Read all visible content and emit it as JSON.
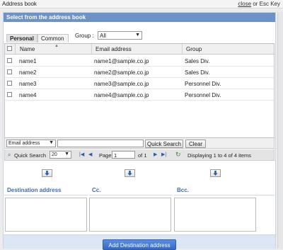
{
  "window": {
    "title": "Address book",
    "close_link": "close",
    "close_suffix": " or Esc Key"
  },
  "dialog": {
    "header": "Select from the address book"
  },
  "tabs": [
    {
      "label": "Personal",
      "active": true
    },
    {
      "label": "Common",
      "active": false
    }
  ],
  "group": {
    "label": "Group :",
    "value": "All"
  },
  "table": {
    "columns": [
      "Name",
      "Email address",
      "Group"
    ],
    "rows": [
      {
        "name": "name1",
        "email": "name1@sample.co.jp",
        "group": "Sales Div."
      },
      {
        "name": "name2",
        "email": "name2@sample.co.jp",
        "group": "Sales Div."
      },
      {
        "name": "name3",
        "email": "name3@sample.co.jp",
        "group": "Personnel Div."
      },
      {
        "name": "name4",
        "email": "name4@sample.co.jp",
        "group": "Personnel Div."
      }
    ]
  },
  "search": {
    "field_select": "Email address",
    "query": "",
    "search_button": "Quick Search",
    "clear_button": "Clear"
  },
  "pager": {
    "quick_search_label": "Quick Search",
    "page_size": "20",
    "page_label": "Page",
    "page_value": "1",
    "of_label": "of 1",
    "status": "Displaying 1 to 4 of 4 items"
  },
  "destination": {
    "to_label": "Destination address",
    "cc_label": "Cc.",
    "bcc_label": "Bcc."
  },
  "footer": {
    "add_button": "Add Destination address"
  },
  "colors": {
    "header": "#6d93c6",
    "accent": "#3f6cb1",
    "primary": "#3568c7"
  },
  "icons": [
    "search-icon",
    "first-page-icon",
    "prev-page-icon",
    "next-page-icon",
    "last-page-icon",
    "refresh-icon",
    "arrow-down-icon"
  ]
}
